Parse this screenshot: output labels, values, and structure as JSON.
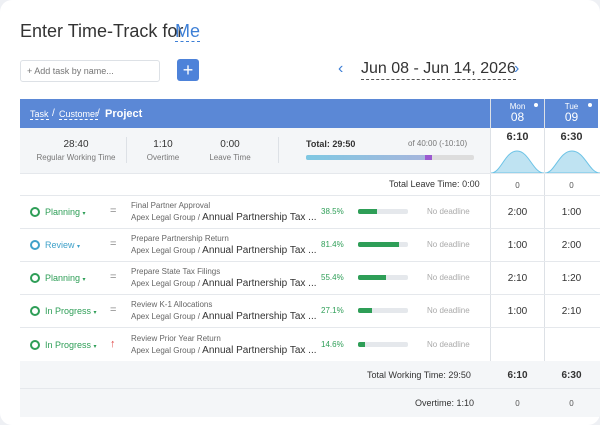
{
  "header": {
    "title": "Enter Time-Track for",
    "user": "Me"
  },
  "toolbar": {
    "add_placeholder": "+ Add task by name...",
    "add_button": "+"
  },
  "date_nav": {
    "range": "Jun 08 - Jun 14, 2026",
    "prev": "‹",
    "next": "›"
  },
  "breadcrumb": {
    "task": "Task",
    "customer": "Customer",
    "project": "Project",
    "sep": "/"
  },
  "days": [
    {
      "name": "Mon",
      "num": "08",
      "total": "6:10",
      "leave": "0",
      "overtime": "0",
      "working_total": "6:10"
    },
    {
      "name": "Tue",
      "num": "09",
      "total": "6:30",
      "leave": "0",
      "overtime": "0",
      "working_total": "6:30"
    }
  ],
  "summary": {
    "regular_value": "28:40",
    "regular_label": "Regular Working Time",
    "overtime_value": "1:10",
    "overtime_label": "Overtime",
    "leave_value": "0:00",
    "leave_label": "Leave Time",
    "total_label": "Total: 29:50",
    "total_of": "of 40:00 (-10:10)",
    "progress": 0.75
  },
  "leave_row": {
    "label": "Total Leave Time:",
    "value": "0:00"
  },
  "tasks": [
    {
      "status": "Planning",
      "caret": "▾",
      "priority": "=",
      "name": "Final Partner Approval",
      "client": "Apex Legal Group",
      "project": "Annual Partnership Tax ...",
      "percent": "38.5%",
      "progress": 0.385,
      "deadline": "No deadline",
      "mon": "2:00",
      "tue": "1:00"
    },
    {
      "status": "Review",
      "caret": "▾",
      "priority": "=",
      "name": "Prepare Partnership Return",
      "client": "Apex Legal Group",
      "project": "Annual Partnership Tax ...",
      "percent": "81.4%",
      "progress": 0.814,
      "deadline": "No deadline",
      "mon": "1:00",
      "tue": "2:00"
    },
    {
      "status": "Planning",
      "caret": "▾",
      "priority": "=",
      "name": "Prepare State Tax Filings",
      "client": "Apex Legal Group",
      "project": "Annual Partnership Tax ...",
      "percent": "55.4%",
      "progress": 0.554,
      "deadline": "No deadline",
      "mon": "2:10",
      "tue": "1:20"
    },
    {
      "status": "In Progress",
      "caret": "▾",
      "priority": "=",
      "name": "Review K-1 Allocations",
      "client": "Apex Legal Group",
      "project": "Annual Partnership Tax ...",
      "percent": "27.1%",
      "progress": 0.271,
      "deadline": "No deadline",
      "mon": "1:00",
      "tue": "2:10"
    },
    {
      "status": "In Progress",
      "caret": "▾",
      "priority": "↑",
      "name": "Review Prior Year Return",
      "client": "Apex Legal Group",
      "project": "Annual Partnership Tax ...",
      "percent": "14.6%",
      "progress": 0.146,
      "deadline": "No deadline",
      "mon": "",
      "tue": ""
    }
  ],
  "footer": {
    "working_label": "Total Working Time:",
    "working_value": "29:50",
    "overtime_label": "Overtime:",
    "overtime_value": "1:10"
  },
  "colors": {
    "accent": "#5b88d6",
    "green": "#2e9e57",
    "review": "#3fa1c9",
    "priority_high": "#e04545"
  },
  "icons": {
    "add": "plus-icon",
    "prev": "chevron-left-icon",
    "next": "chevron-right-icon",
    "status": "clock-icon",
    "priority_normal": "equals-icon",
    "priority_high": "arrow-up-icon"
  }
}
